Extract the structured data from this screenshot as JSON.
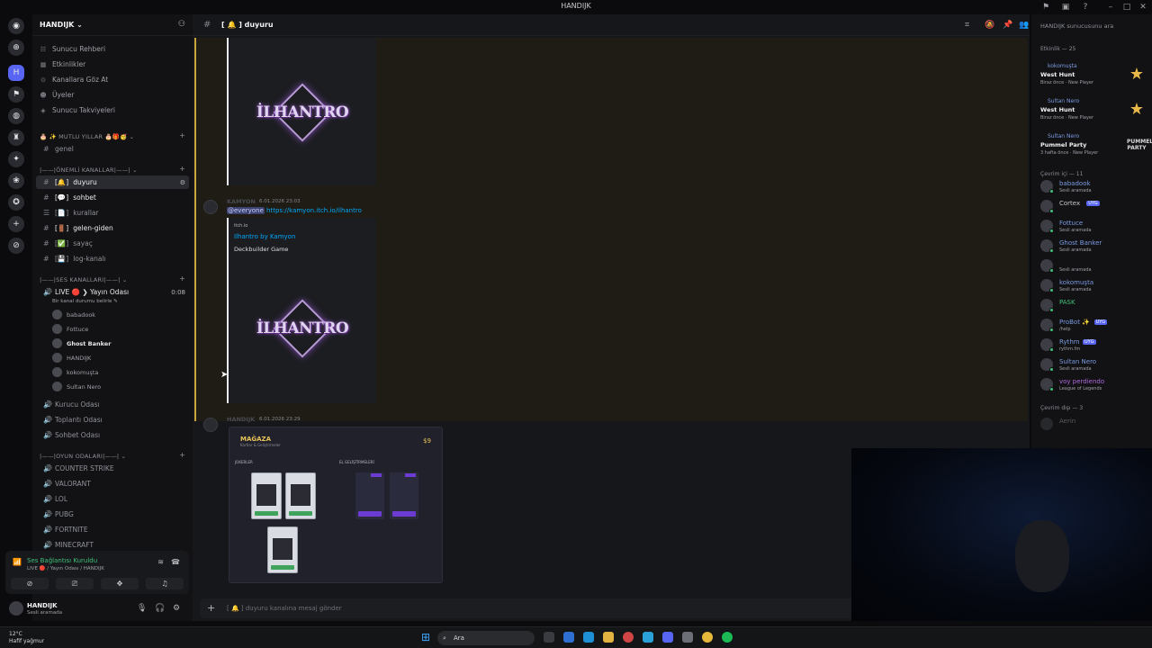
{
  "window": {
    "title": "HANDIJK"
  },
  "server": {
    "name": "HANDIJK ⌄"
  },
  "nav": [
    {
      "icon": "☷",
      "label": "Sunucu Rehberi"
    },
    {
      "icon": "▦",
      "label": "Etkinlikler"
    },
    {
      "icon": "⊙",
      "label": "Kanallara Göz At"
    },
    {
      "icon": "☻",
      "label": "Üyeler"
    },
    {
      "icon": "◈",
      "label": "Sunucu Takviyeleri"
    }
  ],
  "categories": {
    "mutlu": "🎂 ✨ MUTLU YILLAR 🎂🎁🥳 ⌄",
    "onemli": "|——|ÖNEMLİ KANALLAR|——| ⌄",
    "ses": "|——|SES KANALLARI|——| ⌄",
    "oyun": "|——|OYUN ODALARI|——| ⌄"
  },
  "text_channels": {
    "genel": "genel",
    "duyuru": "duyuru",
    "sohbet": "sohbet",
    "kurallar": "kurallar",
    "gelen_giden": "gelen-giden",
    "sayac": "sayaç",
    "log": "log-kanalı"
  },
  "voice": {
    "live_name": "LIVE 🔴 ❯ Yayın Odası",
    "live_time": "0:08",
    "live_status": "Bir kanal durumu belirle ✎",
    "users": [
      "babadook",
      "Fottuce",
      "Ghost Banker",
      "HANDIJK",
      "kokomuşta",
      "Sultan Nero"
    ],
    "others": [
      "Kurucu Odası",
      "Toplantı Odası",
      "Sohbet Odası"
    ]
  },
  "game_channels": [
    "COUNTER STRIKE",
    "VALORANT",
    "LOL",
    "PUBG",
    "FORTNITE",
    "MINECRAFT"
  ],
  "voice_panel": {
    "status": "Ses Bağlantısı Kuruldu",
    "sub": "LIVE 🔴 / Yayın Odası / HANDIJK"
  },
  "user_panel": {
    "name": "HANDIJK",
    "status": "Sesli aramada"
  },
  "channel_header": {
    "name": "[ 🔔 ] duyuru"
  },
  "messages": {
    "m1_author": "KAMYON",
    "m1_time": "6.01.2026 23:03",
    "mention": "@everyone",
    "link": "https://kamyon.itch.io/ilhantro",
    "embed_site": "itch.io",
    "embed_title": "Ilhantro by Kamyon",
    "embed_desc": "Deckbuilder Game",
    "logo_text": "İLHANTRO",
    "m2_author": "HANDIJK",
    "m2_time": "6.01.2026 23:29"
  },
  "shop": {
    "title": "MAĞAZA",
    "subtitle": "Kartlar & Geliştirmeler",
    "price": "$9",
    "sec1": "JOKERLER",
    "sec2": "EL GELİŞTİRMELERİ"
  },
  "composer": {
    "placeholder": "[ 🔔 ] duyuru kanalına mesaj gönder"
  },
  "member_search": "HANDIJK sunucusunu ara",
  "activity_head": "Etkinlik — 25",
  "activities": [
    {
      "who": "kokomuşta",
      "game": "West Hunt",
      "meta": "Biraz önce · New Player",
      "art": "★"
    },
    {
      "who": "Sultan Nero",
      "game": "West Hunt",
      "meta": "Biraz önce · New Player",
      "art": "★"
    },
    {
      "who": "Sultan Nero",
      "game": "Pummel Party",
      "meta": "3 hafta önce · New Player",
      "art": "PUMMEL PARTY"
    }
  ],
  "online_head": "Çevrim içi — 11",
  "members": [
    {
      "name": "babadook",
      "sub": "Sesli aramada",
      "badge": "",
      "color": "#7a9be0"
    },
    {
      "name": "Cortex",
      "sub": "",
      "badge": "UYG",
      "color": "#c9cbd0"
    },
    {
      "name": "Fottuce",
      "sub": "Sesli aramada",
      "badge": "",
      "color": "#7a9be0"
    },
    {
      "name": "Ghost Banker",
      "sub": "Sesli aramada",
      "badge": "",
      "color": "#7a9be0"
    },
    {
      "name": "",
      "sub": "Sesli aramada",
      "badge": "",
      "color": "#7a9be0"
    },
    {
      "name": "kokomuşta",
      "sub": "Sesli aramada",
      "badge": "",
      "color": "#7a9be0"
    },
    {
      "name": "PASK",
      "sub": "",
      "badge": "",
      "color": "#3fc27a"
    },
    {
      "name": "ProBot ✨",
      "sub": "/help",
      "badge": "UYG",
      "color": "#7a9be0"
    },
    {
      "name": "Rythm",
      "sub": "rythm.fm",
      "badge": "UYG",
      "color": "#7a9be0"
    },
    {
      "name": "Sultan Nero",
      "sub": "Sesli aramada",
      "badge": "",
      "color": "#7a9be0"
    },
    {
      "name": "voy perdiendo",
      "sub": "League of Legends",
      "badge": "",
      "color": "#b06adf"
    }
  ],
  "offline_head": "Çevrim dışı — 3",
  "offline_member": "Aerin",
  "taskbar": {
    "weather_temp": "12°C",
    "weather_desc": "Hafif yağmur",
    "search": "Ara"
  }
}
